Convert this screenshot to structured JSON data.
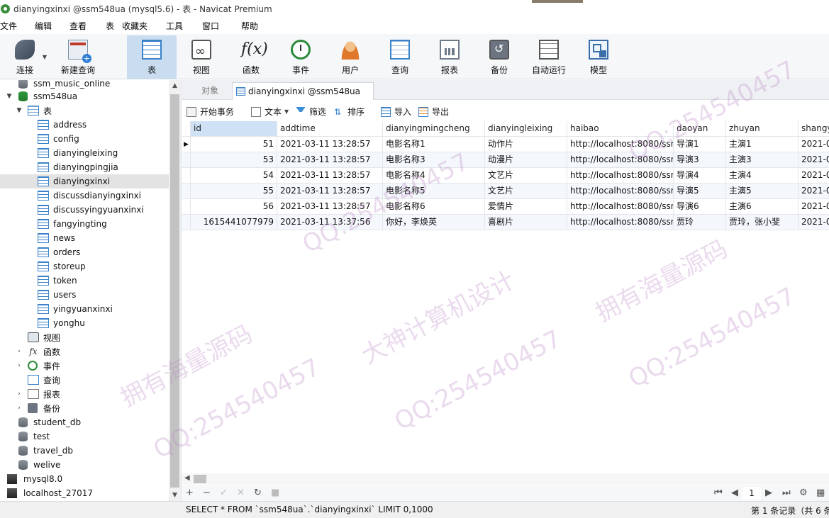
{
  "window": {
    "title": "dianyingxinxi @ssm548ua (mysql5.6) - 表 - Navicat Premium"
  },
  "menu": [
    "文件",
    "编辑",
    "查看",
    "表",
    "收藏夹",
    "工具",
    "窗口",
    "帮助"
  ],
  "toolbar": {
    "connect": "连接",
    "new_query": "新建查询",
    "table": "表",
    "view": "视图",
    "function": "函数",
    "event": "事件",
    "user": "用户",
    "query": "查询",
    "report": "报表",
    "backup": "备份",
    "auto_run": "自动运行",
    "model": "模型"
  },
  "sidebar": {
    "items": [
      {
        "label": "ssm_music_online",
        "icon": "database-icon"
      },
      {
        "label": "ssm548ua",
        "icon": "database-icon"
      },
      {
        "label": "表",
        "icon": "table-folder-icon"
      },
      {
        "label": "address",
        "icon": "table-icon"
      },
      {
        "label": "config",
        "icon": "table-icon"
      },
      {
        "label": "dianyingleixing",
        "icon": "table-icon"
      },
      {
        "label": "dianyingpingjia",
        "icon": "table-icon"
      },
      {
        "label": "dianyingxinxi",
        "icon": "table-icon"
      },
      {
        "label": "discussdianyingxinxi",
        "icon": "table-icon"
      },
      {
        "label": "discussyingyuanxinxi",
        "icon": "table-icon"
      },
      {
        "label": "fangyingting",
        "icon": "table-icon"
      },
      {
        "label": "news",
        "icon": "table-icon"
      },
      {
        "label": "orders",
        "icon": "table-icon"
      },
      {
        "label": "storeup",
        "icon": "table-icon"
      },
      {
        "label": "token",
        "icon": "table-icon"
      },
      {
        "label": "users",
        "icon": "table-icon"
      },
      {
        "label": "yingyuanxinxi",
        "icon": "table-icon"
      },
      {
        "label": "yonghu",
        "icon": "table-icon"
      },
      {
        "label": "视图",
        "icon": "view-folder-icon"
      },
      {
        "label": "函数",
        "icon": "function-folder-icon"
      },
      {
        "label": "事件",
        "icon": "event-folder-icon"
      },
      {
        "label": "查询",
        "icon": "query-folder-icon"
      },
      {
        "label": "报表",
        "icon": "report-folder-icon"
      },
      {
        "label": "备份",
        "icon": "backup-folder-icon"
      },
      {
        "label": "student_db",
        "icon": "database-icon"
      },
      {
        "label": "test",
        "icon": "database-icon"
      },
      {
        "label": "travel_db",
        "icon": "database-icon"
      },
      {
        "label": "welive",
        "icon": "database-icon"
      },
      {
        "label": "mysql8.0",
        "icon": "server-icon"
      },
      {
        "label": "localhost_27017",
        "icon": "server-icon"
      }
    ]
  },
  "tabs": {
    "objects": "对象",
    "active": "dianyingxinxi @ssm548ua (..."
  },
  "data_toolbar": {
    "begin_transaction": "开始事务",
    "text": "文本",
    "filter": "筛选",
    "sort": "排序",
    "import": "导入",
    "export": "导出"
  },
  "grid": {
    "columns": [
      "id",
      "addtime",
      "dianyingmingcheng",
      "dianyingleixing",
      "haibao",
      "daoyan",
      "zhuyan",
      "shangy"
    ],
    "rows": [
      [
        "51",
        "2021-03-11 13:28:57",
        "电影名称1",
        "动作片",
        "http://localhost:8080/ssm",
        "导演1",
        "主演1",
        "2021-0"
      ],
      [
        "53",
        "2021-03-11 13:28:57",
        "电影名称3",
        "动漫片",
        "http://localhost:8080/ssm",
        "导演3",
        "主演3",
        "2021-0"
      ],
      [
        "54",
        "2021-03-11 13:28:57",
        "电影名称4",
        "文艺片",
        "http://localhost:8080/ssm",
        "导演4",
        "主演4",
        "2021-0"
      ],
      [
        "55",
        "2021-03-11 13:28:57",
        "电影名称5",
        "文艺片",
        "http://localhost:8080/ssm",
        "导演5",
        "主演5",
        "2021-0"
      ],
      [
        "56",
        "2021-03-11 13:28:57",
        "电影名称6",
        "爱情片",
        "http://localhost:8080/ssm",
        "导演6",
        "主演6",
        "2021-0"
      ],
      [
        "1615441077979",
        "2021-03-11 13:37:56",
        "你好，李焕英",
        "喜剧片",
        "http://localhost:8080/ssm",
        "贾玲",
        "贾玲，张小斐",
        "2021-0"
      ]
    ]
  },
  "navigation": {
    "page": "1"
  },
  "status": {
    "sql": "SELECT * FROM `ssm548ua`.`dianyingxinxi` LIMIT 0,1000",
    "records": "第 1 条记录（共 6 条"
  },
  "watermarks": [
    "QQ:254540457",
    "大神计算机设计",
    "拥有海量源码"
  ]
}
